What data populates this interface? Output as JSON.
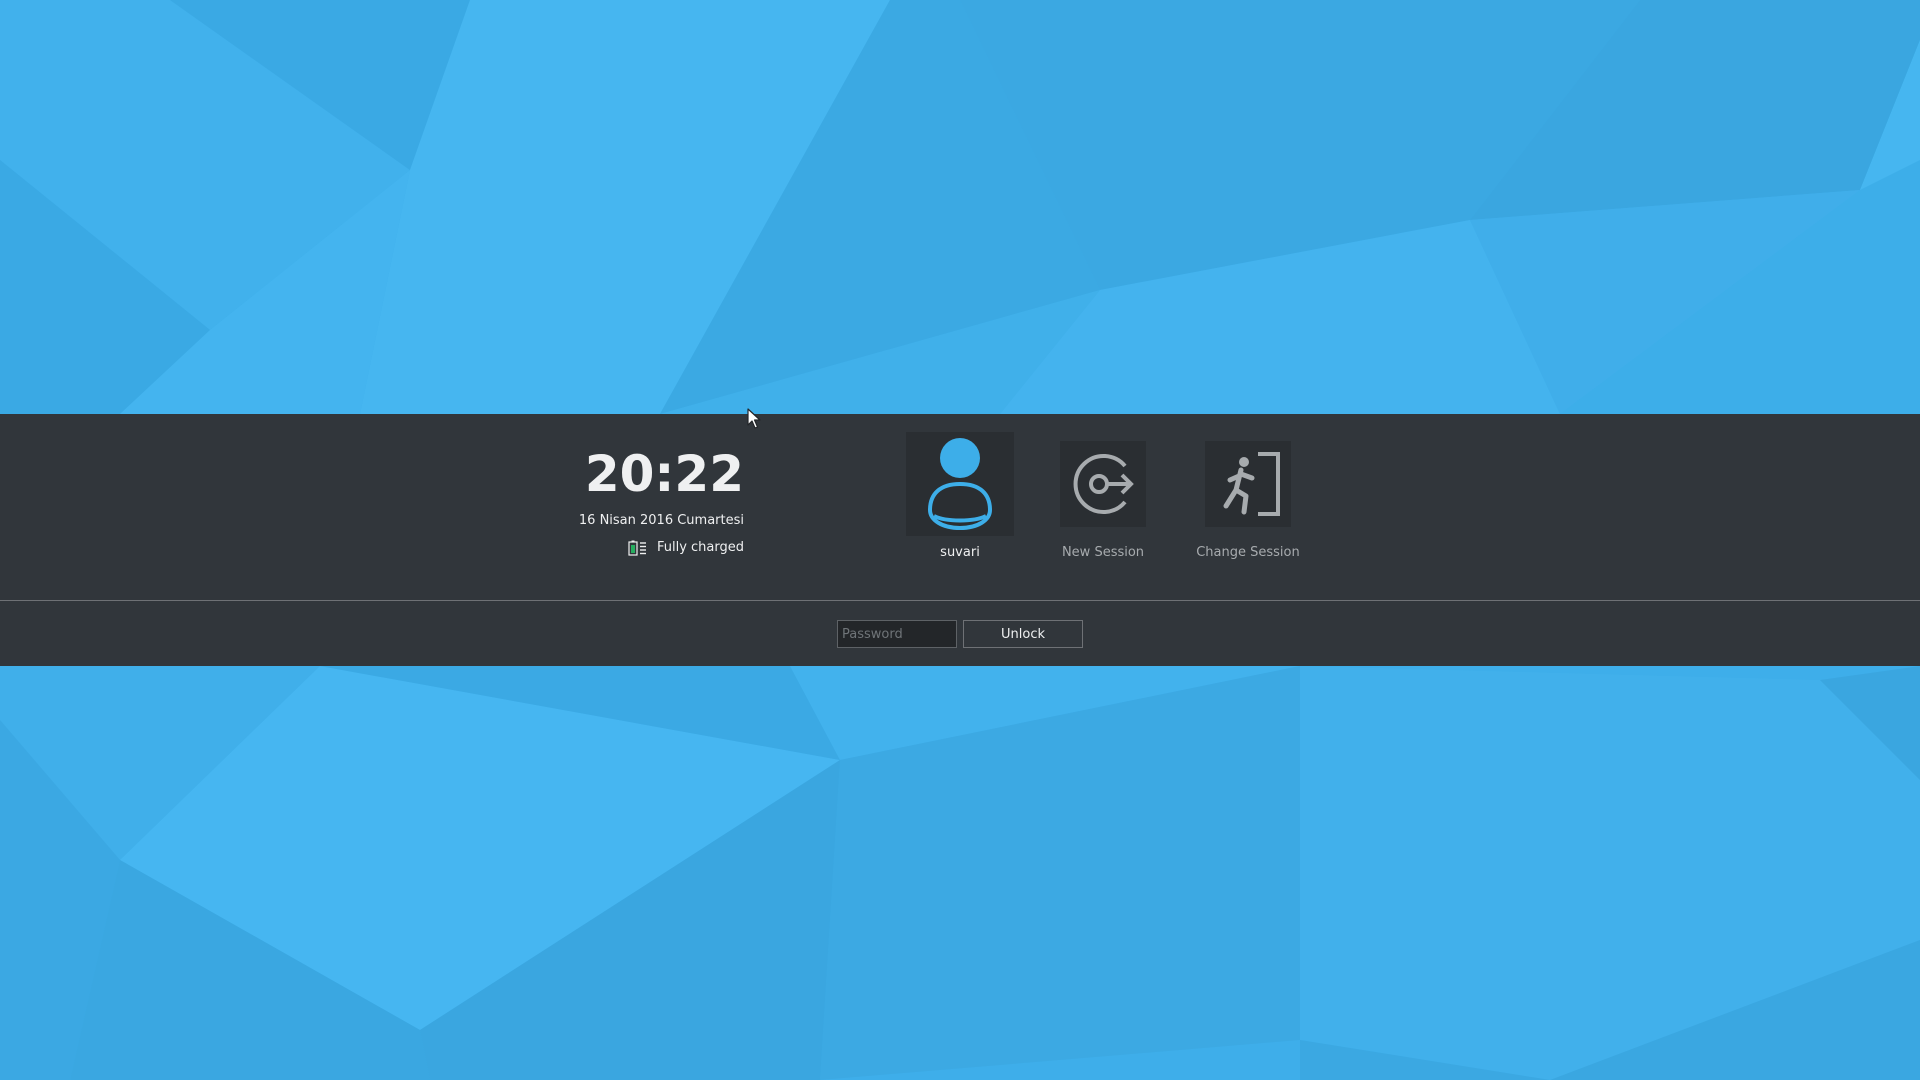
{
  "clock": {
    "time": "20:22",
    "date": "16 Nisan 2016 Cumartesi"
  },
  "battery": {
    "icon": "battery-icon",
    "status": "Fully charged"
  },
  "sessions": {
    "user": {
      "icon": "user-avatar-icon",
      "label": "suvari"
    },
    "new_session": {
      "icon": "new-session-icon",
      "label": "New Session"
    },
    "change_session": {
      "icon": "change-session-icon",
      "label": "Change Session"
    }
  },
  "login": {
    "password_placeholder": "Password",
    "password_value": "",
    "unlock_label": "Unlock"
  },
  "colors": {
    "wallpaper": "#3daee9",
    "panel": "#31363b",
    "accent": "#3daee9",
    "text": "#eff0f1",
    "muted_text": "#a7abae"
  }
}
